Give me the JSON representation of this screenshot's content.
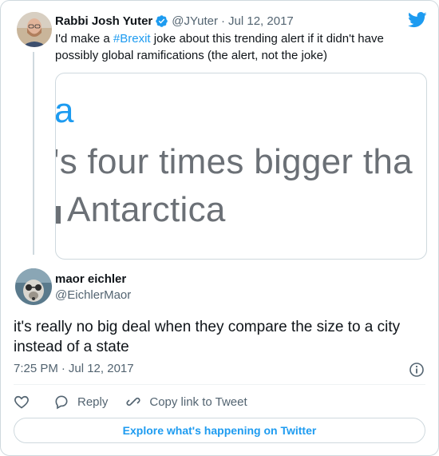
{
  "parent_tweet": {
    "author_name": "Rabbi Josh Yuter",
    "handle": "@JYuter",
    "separator": "·",
    "date": "Jul 12, 2017",
    "text_before": "I'd make a ",
    "hashtag": "#Brexit",
    "text_after": " joke about this trending alert if it didn't have possibly global ramifications (the alert, not the joke)",
    "media_lines": [
      "a",
      "'s four times bigger tha",
      "Antarctica"
    ]
  },
  "reply_tweet": {
    "author_name": "maor eichler",
    "handle": "@EichlerMaor",
    "text": "it's really no big deal when they compare the size to a city instead of a state",
    "time": "7:25 PM",
    "separator": "·",
    "date": "Jul 12, 2017"
  },
  "actions": {
    "reply_label": "Reply",
    "copy_link_label": "Copy link to Tweet"
  },
  "explore_button": "Explore what's happening on Twitter",
  "icons": {
    "brand": "twitter-bird-icon",
    "verified": "verified-badge-icon",
    "info": "info-icon",
    "like": "heart-icon",
    "reply": "reply-bubble-icon",
    "copy": "link-icon"
  },
  "colors": {
    "accent": "#1d9bf0",
    "text": "#0f1419",
    "secondary": "#536471",
    "border": "#cfd9de"
  }
}
